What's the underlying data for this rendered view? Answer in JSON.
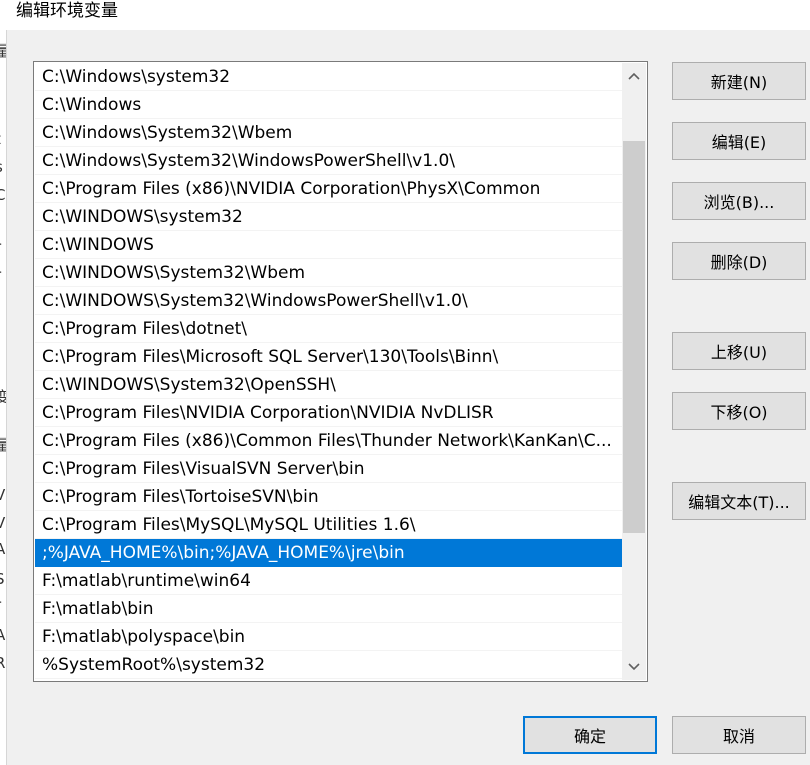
{
  "window": {
    "title": "编辑环境变量"
  },
  "left_fragments": [
    "量",
    "i",
    "t",
    "s",
    "C",
    "r",
    "r",
    "变",
    "量",
    "V",
    "V",
    "A",
    "S",
    "r",
    "A",
    "R"
  ],
  "paths": [
    "C:\\Windows\\system32",
    "C:\\Windows",
    "C:\\Windows\\System32\\Wbem",
    "C:\\Windows\\System32\\WindowsPowerShell\\v1.0\\",
    "C:\\Program Files (x86)\\NVIDIA Corporation\\PhysX\\Common",
    "C:\\WINDOWS\\system32",
    "C:\\WINDOWS",
    "C:\\WINDOWS\\System32\\Wbem",
    "C:\\WINDOWS\\System32\\WindowsPowerShell\\v1.0\\",
    "C:\\Program Files\\dotnet\\",
    "C:\\Program Files\\Microsoft SQL Server\\130\\Tools\\Binn\\",
    "C:\\WINDOWS\\System32\\OpenSSH\\",
    "C:\\Program Files\\NVIDIA Corporation\\NVIDIA NvDLISR",
    "C:\\Program Files (x86)\\Common Files\\Thunder Network\\KanKan\\C...",
    "C:\\Program Files\\VisualSVN Server\\bin",
    "C:\\Program Files\\TortoiseSVN\\bin",
    "C:\\Program Files\\MySQL\\MySQL Utilities 1.6\\",
    ";%JAVA_HOME%\\bin;%JAVA_HOME%\\jre\\bin",
    "F:\\matlab\\runtime\\win64",
    "F:\\matlab\\bin",
    "F:\\matlab\\polyspace\\bin",
    "%SystemRoot%\\system32"
  ],
  "selected_index": 17,
  "buttons": {
    "new": "新建(N)",
    "edit": "编辑(E)",
    "browse": "浏览(B)...",
    "delete": "删除(D)",
    "move_up": "上移(U)",
    "move_down": "下移(O)",
    "edit_text": "编辑文本(T)...",
    "ok": "确定",
    "cancel": "取消"
  },
  "colors": {
    "selection": "#0078d7",
    "background": "#f0f0f0"
  }
}
